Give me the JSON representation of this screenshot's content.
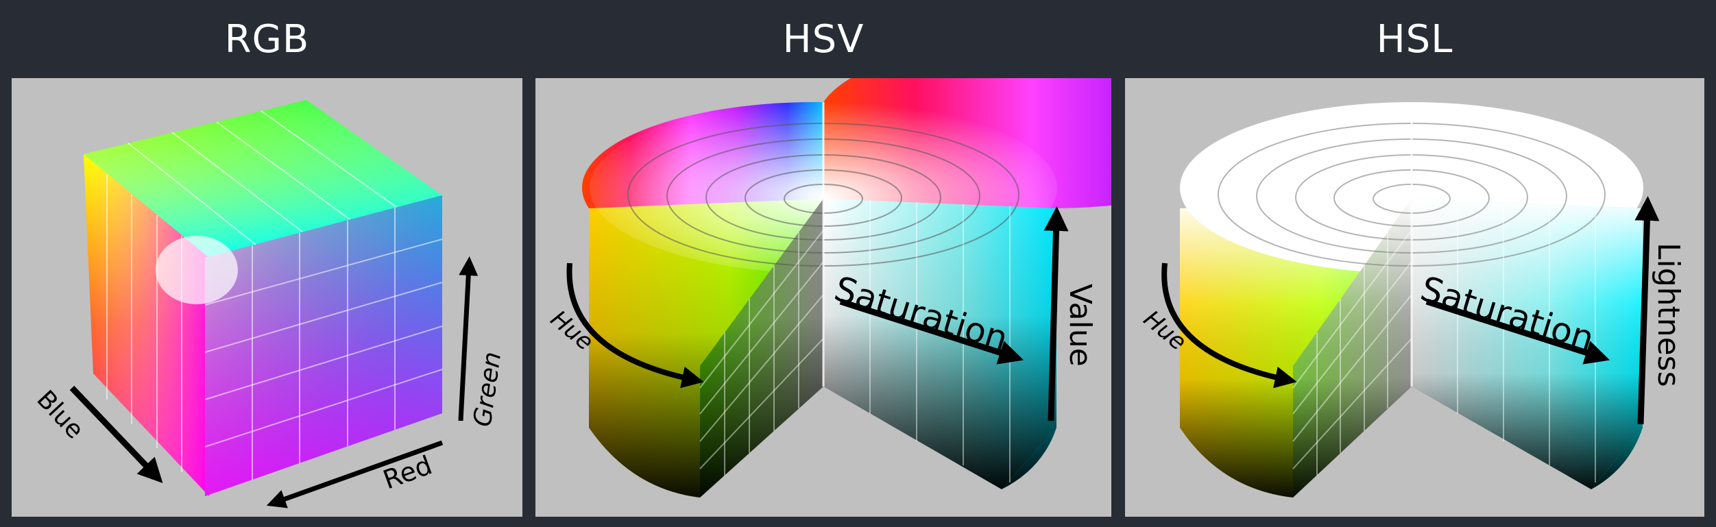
{
  "panels": {
    "rgb": {
      "title": "RGB",
      "axes": {
        "red": "Red",
        "green": "Green",
        "blue": "Blue"
      }
    },
    "hsv": {
      "title": "HSV",
      "axes": {
        "hue": "Hue",
        "saturation": "Saturation",
        "value": "Value"
      }
    },
    "hsl": {
      "title": "HSL",
      "axes": {
        "hue": "Hue",
        "saturation": "Saturation",
        "lightness": "Lightness"
      }
    }
  },
  "colors": {
    "background": "#282c35",
    "panel": "#c0c0c0",
    "arrow": "#000000",
    "title_text": "#ffffff"
  }
}
